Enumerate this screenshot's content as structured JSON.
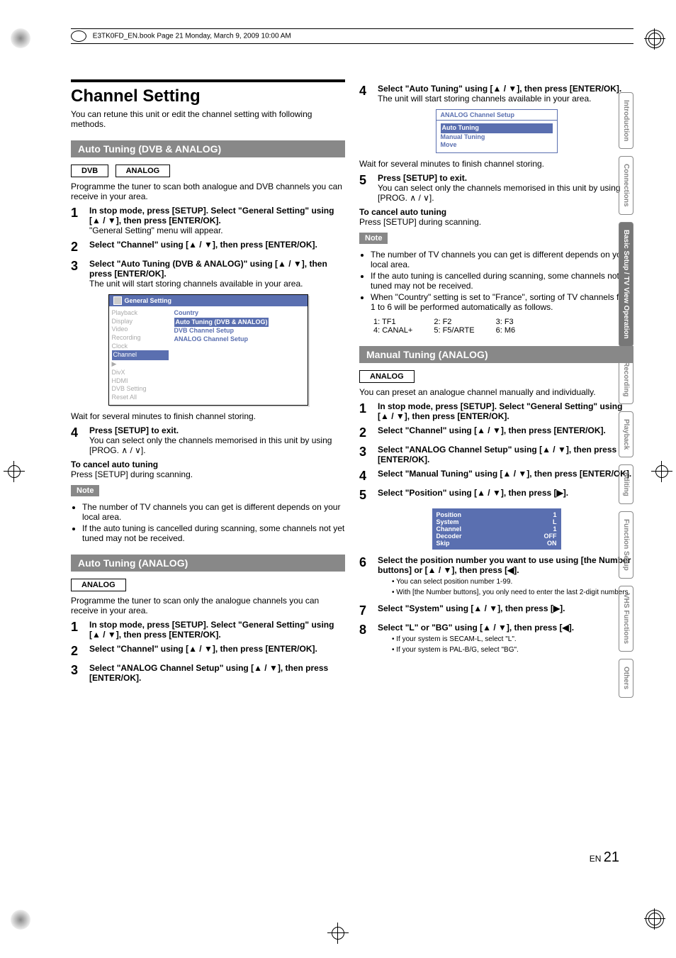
{
  "header": "E3TK0FD_EN.book  Page 21  Monday, March 9, 2009  10:00 AM",
  "side_tabs": [
    "Introduction",
    "Connections",
    "Basic Setup / TV View Operation",
    "Recording",
    "Playback",
    "Editing",
    "Function Setup",
    "VHS Functions",
    "Others"
  ],
  "active_tab_index": 2,
  "title": "Channel Setting",
  "intro": "You can retune this unit or edit the channel setting with following methods.",
  "sec1": {
    "heading": "Auto Tuning (DVB & ANALOG)",
    "tags": [
      "DVB",
      "ANALOG"
    ],
    "desc": "Programme the tuner to scan both analogue and DVB channels you can receive in your area.",
    "steps": [
      {
        "n": "1",
        "bold": "In stop mode, press [SETUP]. Select \"General Setting\" using [▲ / ▼], then press [ENTER/OK].",
        "rest": "\"General Setting\" menu will appear."
      },
      {
        "n": "2",
        "bold": "Select \"Channel\" using [▲ / ▼], then press [ENTER/OK]."
      },
      {
        "n": "3",
        "bold": "Select \"Auto Tuning (DVB & ANALOG)\" using [▲ / ▼], then press [ENTER/OK].",
        "rest": "The unit will start storing channels available in your area."
      }
    ],
    "screen": {
      "title": "General Setting",
      "left": [
        "Playback",
        "Display",
        "Video",
        "Recording",
        "Clock",
        "Channel",
        "DivX",
        "HDMI",
        "DVB Setting",
        "Reset All"
      ],
      "left_selected_index": 5,
      "right_label": "Country",
      "right_items": [
        "Auto Tuning (DVB & ANALOG)",
        "DVB Channel Setup",
        "ANALOG Channel Setup"
      ]
    },
    "post": "Wait for several minutes to finish channel storing.",
    "step4": {
      "n": "4",
      "bold": "Press [SETUP] to exit.",
      "rest": "You can select only the channels memorised in this unit by using [PROG. ∧ / ∨]."
    },
    "cancel_h": "To cancel auto tuning",
    "cancel": "Press [SETUP] during scanning.",
    "notes": [
      "The number of TV channels you can get is different depends on your local area.",
      "If the auto tuning is cancelled during scanning, some channels not yet tuned may not be received."
    ]
  },
  "sec2": {
    "heading": "Auto Tuning (ANALOG)",
    "tags": [
      "ANALOG"
    ],
    "desc": "Programme the tuner to scan only the analogue channels you can receive in your area.",
    "steps": [
      {
        "n": "1",
        "bold": "In stop mode, press [SETUP]. Select \"General Setting\" using [▲ / ▼], then press [ENTER/OK]."
      },
      {
        "n": "2",
        "bold": "Select \"Channel\" using [▲ / ▼], then press [ENTER/OK]."
      },
      {
        "n": "3",
        "bold": "Select \"ANALOG Channel Setup\" using [▲ / ▼], then press [ENTER/OK]."
      }
    ]
  },
  "sec3": {
    "step4": {
      "n": "4",
      "bold": "Select \"Auto Tuning\" using [▲ / ▼], then press [ENTER/OK].",
      "rest": "The unit will start storing channels available in your area."
    },
    "screen2": {
      "title": "ANALOG Channel Setup",
      "items": [
        "Auto Tuning",
        "Manual Tuning",
        "Move"
      ],
      "highlight_index": 0
    },
    "post": "Wait for several minutes to finish channel storing.",
    "step5": {
      "n": "5",
      "bold": "Press [SETUP] to exit.",
      "rest": "You can select only the channels memorised in this unit by using [PROG. ∧ / ∨]."
    },
    "cancel_h": "To cancel auto tuning",
    "cancel": "Press [SETUP] during scanning.",
    "notes": [
      "The number of TV channels you can get is different depends on your local area.",
      "If the auto tuning is cancelled during scanning, some channels not yet tuned may not be received.",
      "When \"Country\" setting is set to \"France\", sorting of TV channels from 1 to 6 will be performed automatically as follows."
    ],
    "table": [
      [
        "1: TF1",
        "2: F2",
        "3: F3"
      ],
      [
        "4: CANAL+",
        "5: F5/ARTE",
        "6: M6"
      ]
    ]
  },
  "sec4": {
    "heading": "Manual Tuning (ANALOG)",
    "tags": [
      "ANALOG"
    ],
    "desc": "You can preset an analogue channel manually and individually.",
    "steps": [
      {
        "n": "1",
        "bold": "In stop mode, press [SETUP]. Select \"General Setting\" using [▲ / ▼], then press [ENTER/OK]."
      },
      {
        "n": "2",
        "bold": "Select \"Channel\" using [▲ / ▼], then press [ENTER/OK]."
      },
      {
        "n": "3",
        "bold": "Select \"ANALOG Channel Setup\" using [▲ / ▼], then press [ENTER/OK]."
      },
      {
        "n": "4",
        "bold": "Select \"Manual Tuning\" using [▲ / ▼], then press [ENTER/OK]."
      },
      {
        "n": "5",
        "bold": "Select \"Position\" using [▲ / ▼], then press [▶]."
      }
    ],
    "screen3": [
      {
        "k": "Position",
        "v": "1"
      },
      {
        "k": "System",
        "v": "L"
      },
      {
        "k": "Channel",
        "v": "1"
      },
      {
        "k": "Decoder",
        "v": "OFF"
      },
      {
        "k": "Skip",
        "v": "ON"
      }
    ],
    "step6": {
      "n": "6",
      "bold": "Select the position number you want to use using [the Number buttons] or [▲ / ▼], then press [◀].",
      "subs": [
        "You can select position number 1-99.",
        "With [the Number buttons], you only need to enter the last 2-digit numbers."
      ]
    },
    "step7": {
      "n": "7",
      "bold": "Select \"System\" using [▲ / ▼], then press [▶]."
    },
    "step8": {
      "n": "8",
      "bold": "Select \"L\" or \"BG\" using [▲ / ▼], then press [◀].",
      "subs": [
        "If your system is SECAM-L, select \"L\".",
        "If your system is PAL-B/G, select \"BG\"."
      ]
    }
  },
  "page_label": "EN",
  "page_number": "21"
}
